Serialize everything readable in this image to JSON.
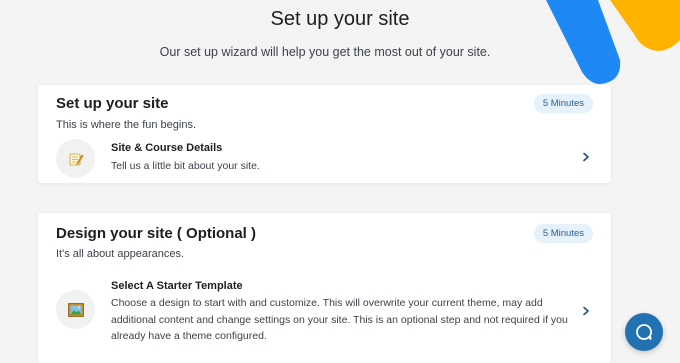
{
  "header": {
    "title": "Set up your site",
    "subtitle": "Our set up wizard will help you get the most out of your site."
  },
  "sections": [
    {
      "title": "Set up your site",
      "description": "This is where the fun begins.",
      "badge": "5 Minutes",
      "step": {
        "title": "Site & Course Details",
        "description": "Tell us a little bit about your site.",
        "icon": "notepad-pencil-icon"
      }
    },
    {
      "title": "Design your site ( Optional )",
      "description": "It's all about appearances.",
      "badge": "5 Minutes",
      "step": {
        "title": "Select A Starter Template",
        "description": "Choose a design to start with and customize. This will overwrite your current theme, may add additional content and change settings on your site. This is an optional step and not required if you already have a theme configured.",
        "icon": "framed-picture-icon"
      }
    }
  ],
  "help": {
    "icon": "chat-bubble-icon"
  },
  "colors": {
    "accent": "#2271b1",
    "badge_bg": "#e5f1fb",
    "deco_blue": "#1e88f5",
    "deco_yellow": "#ffb200"
  }
}
